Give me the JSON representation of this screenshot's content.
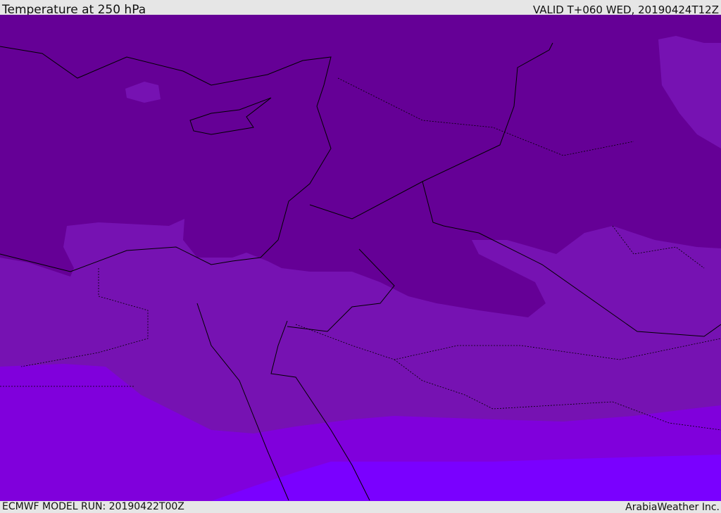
{
  "header": {
    "title": "Temperature at 250 hPa",
    "valid": "VALID T+060 WED, 20190424T12Z"
  },
  "footer": {
    "model_run": "ECMWF MODEL RUN: 20190422T00Z",
    "credit": "ArabiaWeather Inc."
  },
  "legend_colors": {
    "coldest": "#650096",
    "cold": "#7612b2",
    "mild": "#8000dc",
    "warm": "#7a00ff"
  }
}
